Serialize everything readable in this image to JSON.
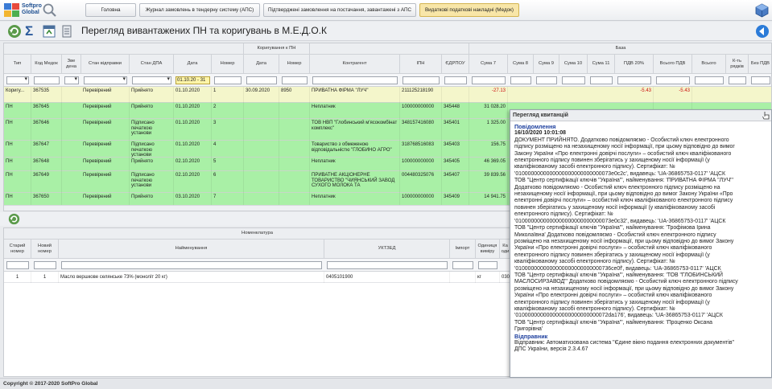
{
  "brand": {
    "line1": "Softpro",
    "line2": "Global"
  },
  "nav_tabs": [
    {
      "label": "Головна",
      "active": false
    },
    {
      "label": "Журнал замовлень в тендерну систему (АПС)",
      "active": false
    },
    {
      "label": "Підтверджені замовлення на постачання, завантажені з АПС",
      "active": false
    },
    {
      "label": "Видаткові податкові накладні (Медок)",
      "active": true
    }
  ],
  "toolbar": {
    "title": "Перегляд вивантажених ПН та коригувань в М.Е.Д.О.К"
  },
  "grid": {
    "group_headers": {
      "correction": "Коригування к ПН",
      "base": "База"
    },
    "columns": {
      "type": "Тип",
      "medok_code": "Код Медок",
      "zv_den": "Зве дена",
      "send_state": "Стан відправки",
      "dpa_state": "Стан ДПА",
      "date": "Дата",
      "number": "Номер",
      "corr_date": "Дата",
      "corr_number": "Номер",
      "counterparty": "Контрагент",
      "ipn": "ІПН",
      "edrpou": "ЄДРПОУ",
      "sum7": "Сума 7",
      "sum8": "Сума 8",
      "sum9": "Сума 9",
      "sum10": "Сума 10",
      "sum11": "Сума 11",
      "pdv20": "ПДВ 20%",
      "total_pdv": "Всього ПДВ",
      "total": "Всього",
      "rows_count": "К-ть рядків",
      "no_pdv": "Без ПДВ"
    },
    "date_filter": "01.10.20 - 31",
    "rows": [
      {
        "type": "Коригу...",
        "code": "367535",
        "send": "Перевірений",
        "dpa": "Прийнято",
        "date": "01.10.2020",
        "num": "1",
        "cdate": "30.09.2020",
        "cnum": "8950",
        "party": "ПРИВАТНА ФІРМА \"ЛУЧ\"",
        "ipn": "211125218190",
        "edrpou": "",
        "sum7": "-27.13",
        "pdv": "-5.43",
        "tpdv": "-5.43",
        "color": "yellow"
      },
      {
        "type": "ПН",
        "code": "367645",
        "send": "Перевірений",
        "dpa": "Прийнято",
        "date": "01.10.2020",
        "num": "2",
        "cdate": "",
        "cnum": "",
        "party": "Неплатник",
        "ipn": "100000000000",
        "edrpou": "345448",
        "sum7": "31 028.20",
        "pdv": "",
        "tpdv": "",
        "color": "green"
      },
      {
        "type": "ПН",
        "code": "367646",
        "send": "Перевірений",
        "dpa": "Підписано печаткою установи",
        "date": "01.10.2020",
        "num": "3",
        "cdate": "",
        "cnum": "",
        "party": "ТОВ НВП \"Глобинський м'ясокомбінат комплекс\"",
        "ipn": "348157416080",
        "edrpou": "345401",
        "sum7": "1 325.00",
        "pdv": "",
        "tpdv": "",
        "color": "green"
      },
      {
        "type": "ПН",
        "code": "367647",
        "send": "Перевірений",
        "dpa": "Підписано печаткою установи",
        "date": "01.10.2020",
        "num": "4",
        "cdate": "",
        "cnum": "",
        "party": "Товариство з обмеженою відповідальністю \"ГЛОБИНО АГРО\"",
        "ipn": "318768516083",
        "edrpou": "345403",
        "sum7": "156.75",
        "pdv": "",
        "tpdv": "",
        "color": "green"
      },
      {
        "type": "ПН",
        "code": "367648",
        "send": "Перевірений",
        "dpa": "Прийнято",
        "date": "02.10.2020",
        "num": "5",
        "cdate": "",
        "cnum": "",
        "party": "Неплатник",
        "ipn": "100000000000",
        "edrpou": "345405",
        "sum7": "46 369.05",
        "pdv": "",
        "tpdv": "",
        "color": "green"
      },
      {
        "type": "ПН",
        "code": "367649",
        "send": "Перевірений",
        "dpa": "Підписано печаткою установи",
        "date": "02.10.2020",
        "num": "6",
        "cdate": "",
        "cnum": "",
        "party": "ПРИВАТНЕ АКЦІОНЕРНЕ ТОВАРИСТВО \"ЧИЯНСЬКИЙ ЗАВОД СУХОГО МОЛОКА ТА",
        "ipn": "004480325076",
        "edrpou": "345407",
        "sum7": "39 839.56",
        "pdv": "",
        "tpdv": "",
        "color": "green"
      },
      {
        "type": "ПН",
        "code": "367650",
        "send": "Перевірений",
        "dpa": "Прийнято",
        "date": "03.10.2020",
        "num": "7",
        "cdate": "",
        "cnum": "",
        "party": "Неплатник",
        "ipn": "100000000000",
        "edrpou": "345409",
        "sum7": "14 941.75",
        "pdv": "",
        "tpdv": "",
        "color": "green"
      }
    ]
  },
  "lower_grid": {
    "group_header": "Номенклатура",
    "columns": {
      "old_num": "Старий номер",
      "new_num": "Новий номер",
      "name": "Найменування",
      "uktzed": "УКТЗЕД",
      "import": "Імпорт",
      "unit": "Одиниця виміру",
      "code": "Ка оди"
    },
    "rows": [
      {
        "old": "1",
        "new": "1",
        "name": "Масло вершкове селянське 73% (моноліт 20 кг)",
        "uktzed": "0405101900",
        "import": "",
        "unit": "кг",
        "code": "030"
      }
    ]
  },
  "receipt": {
    "title": "Перегляд квитанцій",
    "message_header": "Повідомлення",
    "timestamp": "16/10/2020 10:01:08",
    "lines": [
      "ДОКУМЕНТ ПРИЙНЯТО. Додатково повідомляємо - Особистий ключ електронного",
      "підпису розміщено на незахищеному носії інформації, при цьому відповідно до вимог",
      "Закону України «Про електронні довірчі послуги» – особистий ключ кваліфікованого",
      "електронного підпису повинен зберігатись у захищеному носії інформації (у",
      "кваліфікованому засобі електронного підпису). Сертифікат: №",
      "'0100000000000000000000000000073e0c2c', видавець: 'UA-36865753-0117' 'АЦСК",
      "ТОВ \"Центр сертифікації ключів \"Україна\"', найменування: 'ПРИВАТНА ФІРМА \"ЛУЧ\"'",
      "Додатково повідомляємо - Особистий ключ електронного підпису розміщено на",
      "незахищеному носії інформації, при цьому відповідно до вимог Закону України «Про",
      "електронні довірчі послуги» – особистий ключ кваліфікованого електронного підпису",
      "повинен зберігатись у захищеному носії інформації (у кваліфікованому засобі",
      "електронного підпису). Сертифікат: №",
      "'0100000000000000000000000000073e0c32', видавець: 'UA-36865753-0117' 'АЦСК",
      "ТОВ \"Центр сертифікації ключів \"Україна\"', найменування: 'Трофімова Ірина",
      "Миколаївна' Додатково повідомляємо - Особистий ключ електронного підпису",
      "розміщено на незахищеному носії інформації, при цьому відповідно до вимог Закону",
      "України «Про електронні довірчі послуги» – особистий ключ кваліфікованого",
      "електронного підпису повинен зберігатись у захищеному носії інформації (у",
      "кваліфікованому засобі електронного підпису). Сертифікат: №",
      "'0100000000000000000000000000736ce0f', видавець: 'UA-36865753-0117' 'АЦСК",
      "ТОВ \"Центр сертифікації ключів \"Україна\"', найменування: 'ТОВ \"ГЛОБИНСЬКИЙ",
      "МАСЛОСИРЗАВОД\"' Додатково повідомляємо - Особистий ключ електронного підпису",
      "розміщено на незахищеному носії інформації, при цьому відповідно до вимог Закону",
      "України «Про електронні довірчі послуги» – особистий ключ кваліфікованого",
      "електронного підпису повинен зберігатись у захищеному носії інформації (у",
      "кваліфікованому засобі електронного підпису). Сертифікат: №",
      "'010000000000000000000000000072da176', видавець: 'UA-36865753-0117' 'АЦСК",
      "ТОВ \"Центр сертифікації ключів \"Україна\"', найменування: 'Проценко Оксана",
      "Григорівна'"
    ],
    "sender_header": "Відправник",
    "sender_lines": [
      "Відправник: Автоматизована система \"Єдине вікно подання електронних документів\"",
      "ДПС України, версія 2.3.4.67"
    ]
  },
  "footer": {
    "copyright": "Copyright © 2017-2020 SoftPro Global"
  },
  "colors": {
    "green_row": "#a9f0a6",
    "yellow_row": "#f4f6cb",
    "active_tab": "#f8e6a8",
    "heading_blue": "#1d3f9e"
  }
}
